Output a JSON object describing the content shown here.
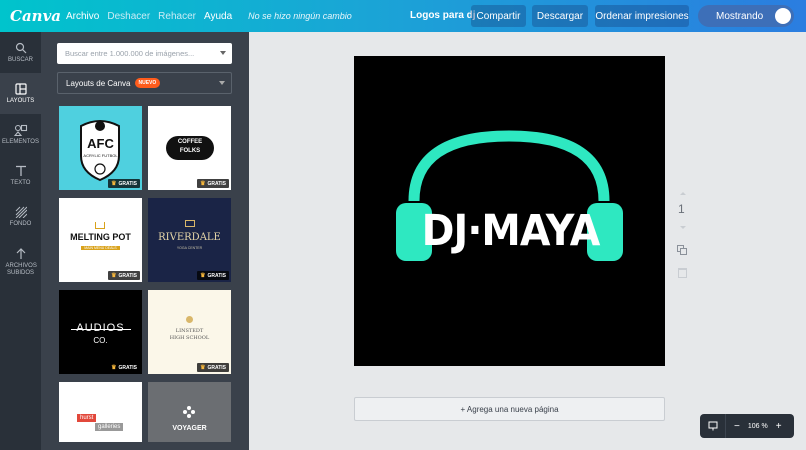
{
  "app": {
    "logo": "Canva"
  },
  "menu": {
    "archivo": "Archivo",
    "deshacer": "Deshacer",
    "rehacer": "Rehacer",
    "ayuda": "Ayuda",
    "status": "No se hizo ningún cambio"
  },
  "header": {
    "doc_title": "Logos para dj",
    "share": "Compartir",
    "download": "Descargar",
    "order": "Ordenar impresiones",
    "toggle_label": "Mostrando"
  },
  "sidebar": {
    "items": [
      {
        "label": "BUSCAR",
        "icon": "search-icon"
      },
      {
        "label": "LAYOUTS",
        "icon": "layouts-icon"
      },
      {
        "label": "ELEMENTOS",
        "icon": "shapes-icon"
      },
      {
        "label": "TEXTO",
        "icon": "text-icon"
      },
      {
        "label": "FONDO",
        "icon": "background-icon"
      },
      {
        "label": "ARCHIVOS SUBIDOS",
        "icon": "upload-icon"
      }
    ]
  },
  "panel": {
    "search_placeholder": "Buscar entre 1.000.000 de imágenes...",
    "layouts_label": "Layouts de Canva",
    "new_badge": "NUEVO",
    "gratis": "GRATIS",
    "thumbs": {
      "afc_title": "AFC",
      "afc_sub": "ACRYLIC FUTBOL",
      "coffee_1": "COFFEE",
      "coffee_2": "FOLKS",
      "melting": "MELTING POT",
      "melting_sub": "MAIN MENU DEALS",
      "riverdale": "RIVERDALE",
      "riverdale_sub": "YOGA CENTER",
      "audios": "AUDIOS",
      "audios_sub": "CO.",
      "linstedt_1": "LINSTEDT",
      "linstedt_2": "HIGH SCHOOL",
      "hurst_1": "hurst",
      "hurst_2": "galleries",
      "voyager": "VOYAGER"
    }
  },
  "canvas": {
    "logo_text": "DJ·MAYA",
    "accent": "#2ee8c1"
  },
  "page": {
    "number": "1",
    "add_page": "+ Agrega una nueva página"
  },
  "zoom": {
    "minus": "−",
    "value": "106 %",
    "plus": "+"
  }
}
